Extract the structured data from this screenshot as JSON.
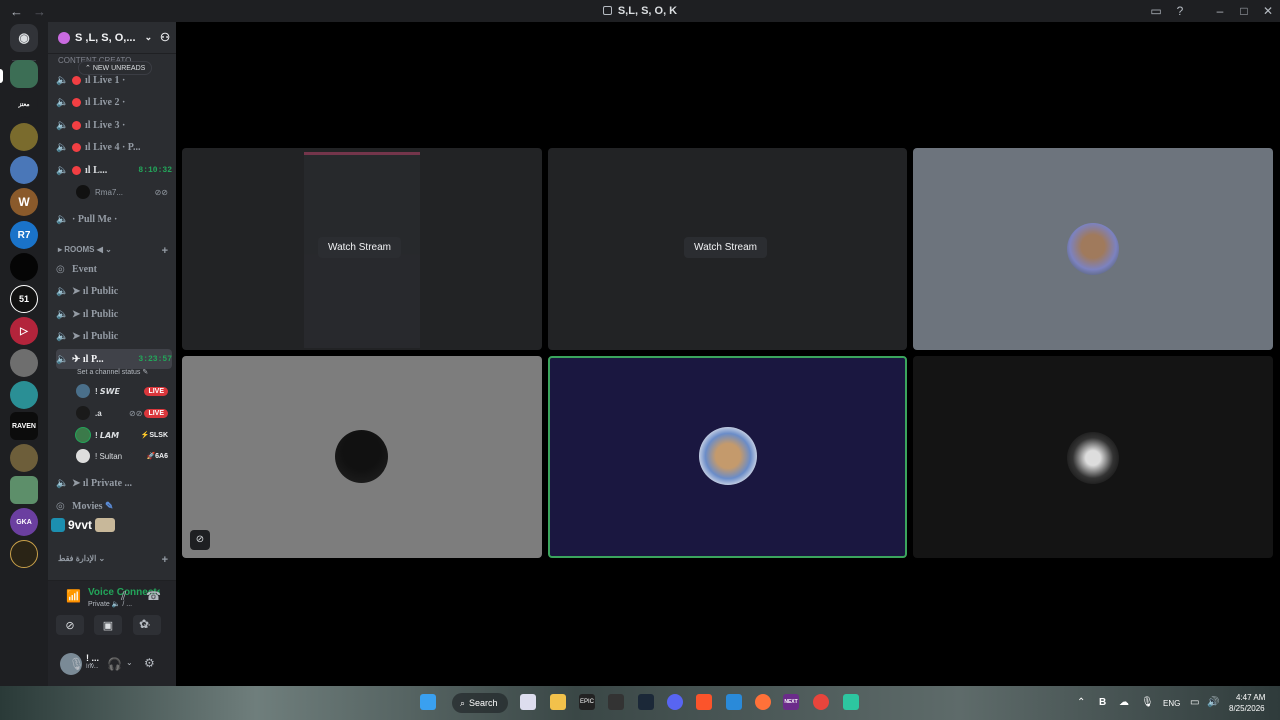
{
  "window": {
    "title": "S,L, S, O, K"
  },
  "server": {
    "name": "S ,L, S, O,...",
    "new_unreads": "NEW UNREADS",
    "ghost_category": "CONTENT CREATO"
  },
  "channels": {
    "live1": "Live 1",
    "live2": "Live 2",
    "live3": "Live 3",
    "live4": "Live 4 · P...",
    "live5": "L...",
    "live5_timer": "8:10:32",
    "live5_user": "Rma7...",
    "pull": "· Pull Me ·",
    "rooms_category": "ROOMS",
    "event": "Event",
    "public1": "Public",
    "public2": "Public",
    "public3": "Public",
    "active": "P...",
    "active_timer": "3:23:57",
    "status_hint": "Set a channel status",
    "private": "Private ...",
    "movies": "Movies",
    "arabic_category": "الإدارة فقط"
  },
  "voice_users": [
    {
      "name": "! 𝙎𝙒𝙀",
      "badge": "LIVE"
    },
    {
      "name": ".a",
      "badge": "LIVE"
    },
    {
      "name": "! 𝙇𝘼𝙈",
      "tag": "⚡SLSK"
    },
    {
      "name": "! Sultan",
      "tag": "🚀6A6"
    }
  ],
  "sticker_text": "9vvt",
  "voice_panel": {
    "title": "Voice Connected",
    "subtitle": "Private 🔈 / ...",
    "me_name": "! ...",
    "me_status": "Inv..."
  },
  "stage": {
    "watch1": "Watch Stream",
    "watch2": "Watch Stream"
  },
  "taskbar": {
    "search": "Search",
    "lang": "ENG",
    "time": "4:47 AM",
    "date": "8/25/2026",
    "next_label": "NEXT"
  },
  "colors": {
    "accent_green": "#23a55a",
    "live_red": "#da373c",
    "speaking_border": "#3ba55d"
  }
}
